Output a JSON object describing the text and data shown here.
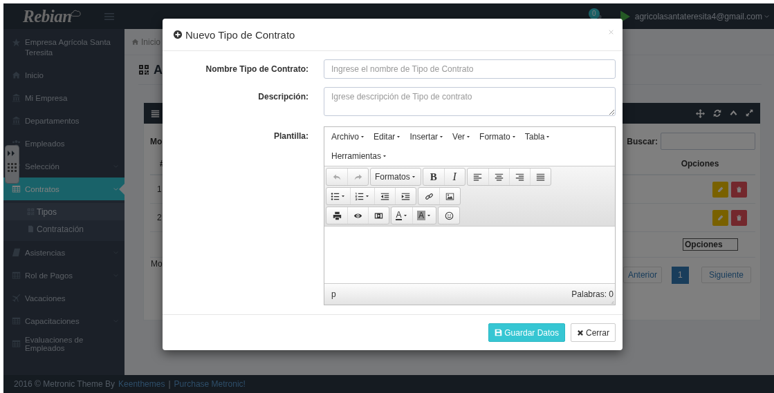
{
  "header": {
    "logo": "Rebian",
    "notification_count": "0",
    "user_email": "agricolasantateresita4@gmail.com"
  },
  "sidebar": {
    "items": [
      {
        "label": "Empresa Agrícola Santa Teresita",
        "submenu": false,
        "selected": false
      },
      {
        "label": "Inicio",
        "submenu": false,
        "selected": false
      },
      {
        "label": "Mi Empresa",
        "submenu": false,
        "selected": false
      },
      {
        "label": "Departamentos",
        "submenu": false,
        "selected": false
      },
      {
        "label": "Empleados",
        "submenu": false,
        "selected": false
      },
      {
        "label": "Selección",
        "submenu": true,
        "selected": false
      },
      {
        "label": "Contratos",
        "submenu": true,
        "selected": true,
        "children": [
          {
            "label": "Tipos",
            "selected": true
          },
          {
            "label": "Contratación",
            "selected": false
          }
        ]
      },
      {
        "label": "Asistencias",
        "submenu": true,
        "selected": false
      },
      {
        "label": "Rol de Pagos",
        "submenu": true,
        "selected": false
      },
      {
        "label": "Vacaciones",
        "submenu": false,
        "selected": false
      },
      {
        "label": "Capacitaciones",
        "submenu": true,
        "selected": false
      },
      {
        "label": "Evaluaciones de Empleados",
        "submenu": false,
        "selected": false
      }
    ]
  },
  "page": {
    "breadcrumb": "Inicio",
    "title": "A",
    "table_panel": {
      "show_entries": "Mo",
      "search_label": "Buscar:",
      "columns": [
        "#",
        "Opciones"
      ],
      "rows": [
        {
          "number": "1"
        },
        {
          "number": "2"
        }
      ],
      "column_filter": {
        "value": "Opciones"
      },
      "info": "Mo",
      "pagination": {
        "previous": "Anterior",
        "pages": [
          {
            "label": "1",
            "selected": true
          }
        ],
        "next": "Siguiente"
      }
    }
  },
  "modal": {
    "title": "Nuevo Tipo de Contrato",
    "fields": [
      {
        "kind": "input",
        "label": "Nombre Tipo de Contrato:",
        "placeholder": "Ingrese el nombre de Tipo de Contrato"
      },
      {
        "kind": "textarea",
        "label": "Descripción:",
        "placeholder": "Igrese descripción de Tipo de contrato"
      },
      {
        "kind": "editor",
        "label": "Plantilla:"
      }
    ],
    "editor": {
      "menus": [
        "Archivo",
        "Editar",
        "Insertar",
        "Ver",
        "Formato",
        "Tabla",
        "Herramientas"
      ],
      "toolbar": [
        [
          [
            {
              "kind": "undo",
              "disabled": true,
              "dropdown": false
            },
            {
              "kind": "redo",
              "disabled": true,
              "dropdown": false
            }
          ],
          [
            {
              "kind": "formats",
              "text": "Formatos",
              "disabled": false,
              "dropdown": true
            }
          ],
          [
            {
              "kind": "bold",
              "text": "B",
              "disabled": false,
              "dropdown": false
            },
            {
              "kind": "italic",
              "text": "I",
              "disabled": false,
              "dropdown": false
            }
          ],
          [
            {
              "kind": "alignleft",
              "disabled": false,
              "dropdown": false
            },
            {
              "kind": "aligncenter",
              "disabled": false,
              "dropdown": false
            },
            {
              "kind": "alignright",
              "disabled": false,
              "dropdown": false
            },
            {
              "kind": "justify",
              "disabled": false,
              "dropdown": false
            }
          ]
        ],
        [
          [
            {
              "kind": "bullist",
              "disabled": false,
              "dropdown": true
            },
            {
              "kind": "numlist",
              "disabled": false,
              "dropdown": true
            },
            {
              "kind": "outdent",
              "disabled": false,
              "dropdown": false
            },
            {
              "kind": "indent",
              "disabled": false,
              "dropdown": false
            }
          ],
          [
            {
              "kind": "link",
              "disabled": false,
              "dropdown": false
            },
            {
              "kind": "image",
              "disabled": false,
              "dropdown": false
            }
          ]
        ],
        [
          [
            {
              "kind": "print",
              "disabled": false,
              "dropdown": false
            },
            {
              "kind": "eye",
              "disabled": false,
              "dropdown": false
            },
            {
              "kind": "media",
              "disabled": false,
              "dropdown": false
            }
          ],
          [
            {
              "kind": "forecolor",
              "text": "A",
              "disabled": false,
              "dropdown": true
            },
            {
              "kind": "backcolor",
              "text": "A",
              "disabled": false,
              "dropdown": true
            }
          ],
          [
            {
              "kind": "smiley",
              "disabled": false,
              "dropdown": false
            }
          ]
        ]
      ],
      "path": "p",
      "word_count": "Palabras: 0"
    },
    "buttons": [
      {
        "kind": "primary",
        "label": "Guardar Datos"
      },
      {
        "kind": "default",
        "label": "Cerrar"
      }
    ]
  },
  "footer": {
    "text": "2016 © Metronic Theme By",
    "links": [
      "Keenthemes",
      "Purchase Metronic!"
    ],
    "separator": "|"
  }
}
